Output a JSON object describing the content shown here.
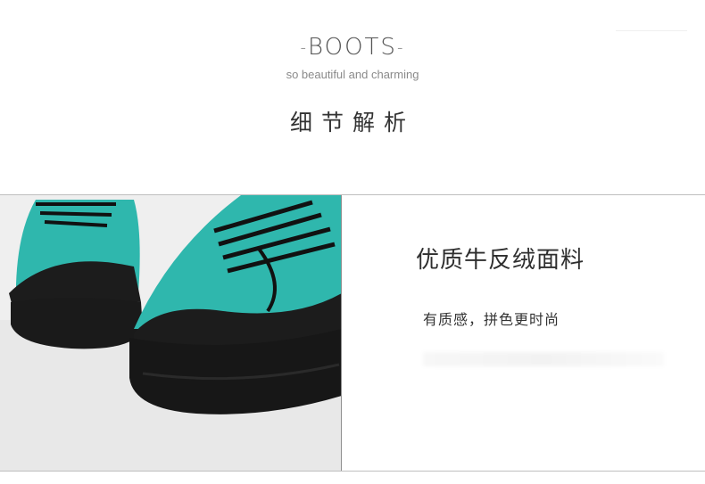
{
  "header": {
    "title": "BOOTS",
    "subtitle": "so beautiful and charming",
    "section_title": "细节解析"
  },
  "detail": {
    "title": "优质牛反绒面料",
    "description": "有质感，拼色更时尚"
  },
  "colors": {
    "suede_teal": "#2fb7ad",
    "sole_black": "#1a1a1a",
    "background": "#e9e9e9"
  }
}
